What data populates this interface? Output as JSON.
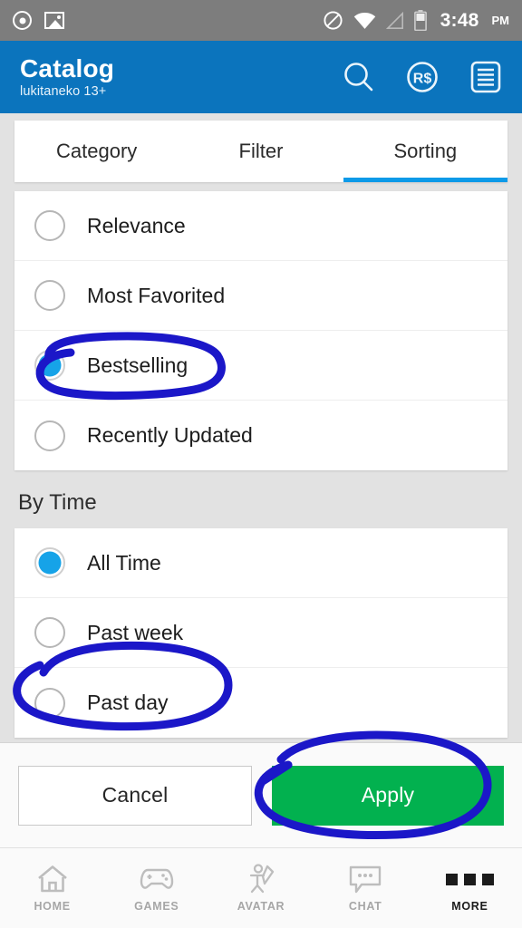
{
  "statusbar": {
    "left_icons": [
      "disc-icon",
      "photo-icon"
    ],
    "right_icons": [
      "do-not-disturb-icon",
      "wifi-icon",
      "cell-signal-icon",
      "battery-icon"
    ],
    "time": "3:48",
    "ampm": "PM"
  },
  "header": {
    "title": "Catalog",
    "subtitle": "lukitaneko 13+",
    "actions": [
      "search-icon",
      "robux-icon",
      "menu-icon"
    ],
    "background_color": "#0b74bd"
  },
  "tabs": [
    {
      "label": "Category",
      "active": false
    },
    {
      "label": "Filter",
      "active": false
    },
    {
      "label": "Sorting",
      "active": true
    }
  ],
  "sorting": {
    "options": [
      {
        "label": "Relevance",
        "selected": false
      },
      {
        "label": "Most Favorited",
        "selected": false
      },
      {
        "label": "Bestselling",
        "selected": true
      },
      {
        "label": "Recently Updated",
        "selected": false
      }
    ]
  },
  "by_time": {
    "section_title": "By Time",
    "options": [
      {
        "label": "All Time",
        "selected": true
      },
      {
        "label": "Past week",
        "selected": false
      },
      {
        "label": "Past day",
        "selected": false
      }
    ]
  },
  "footer": {
    "cancel_label": "Cancel",
    "apply_label": "Apply",
    "apply_color": "#02b14f"
  },
  "bottom_nav": [
    {
      "label": "HOME",
      "icon": "home-icon",
      "active": false
    },
    {
      "label": "GAMES",
      "icon": "gamepad-icon",
      "active": false
    },
    {
      "label": "AVATAR",
      "icon": "avatar-icon",
      "active": false
    },
    {
      "label": "CHAT",
      "icon": "chat-icon",
      "active": false
    },
    {
      "label": "MORE",
      "icon": "more-dots-icon",
      "active": true
    }
  ],
  "annotations": {
    "color": "#1b17c8",
    "marks": [
      {
        "name": "circle-bestselling",
        "target": "Bestselling"
      },
      {
        "name": "circle-past-day",
        "target": "Past day"
      },
      {
        "name": "circle-apply",
        "target": "Apply"
      }
    ]
  },
  "accent": {
    "radio_selected": "#16a3e8",
    "tab_underline": "#0d9ae8"
  }
}
